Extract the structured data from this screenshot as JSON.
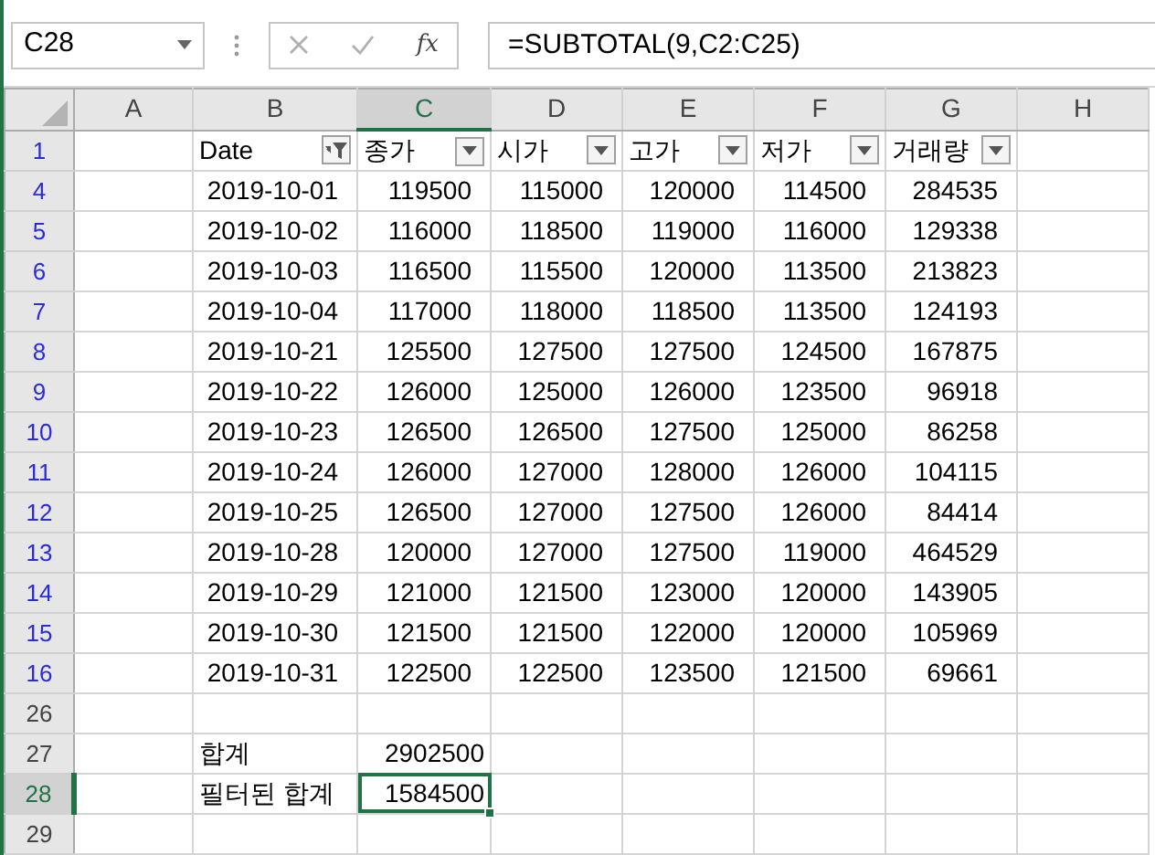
{
  "name_box": {
    "value": "C28"
  },
  "formula_bar": {
    "function_label": "fx",
    "formula": "=SUBTOTAL(9,C2:C25)"
  },
  "columns": [
    {
      "label": "A",
      "selected": false
    },
    {
      "label": "B",
      "selected": false
    },
    {
      "label": "C",
      "selected": true
    },
    {
      "label": "D",
      "selected": false
    },
    {
      "label": "E",
      "selected": false
    },
    {
      "label": "F",
      "selected": false
    },
    {
      "label": "G",
      "selected": false
    },
    {
      "label": "H",
      "selected": false
    }
  ],
  "rows": [
    {
      "number": "1",
      "kind": "header",
      "filtered": true,
      "selected": false,
      "cells": [
        null,
        {
          "text": "Date",
          "filtered": true
        },
        {
          "text": "종가",
          "filtered": false
        },
        {
          "text": "시가",
          "filtered": false
        },
        {
          "text": "고가",
          "filtered": false
        },
        {
          "text": "저가",
          "filtered": false
        },
        {
          "text": "거래량",
          "filtered": false
        }
      ]
    },
    {
      "number": "4",
      "kind": "data",
      "filtered": true,
      "selected": false,
      "cells": [
        null,
        "2019-10-01",
        "119500",
        "115000",
        "120000",
        "114500",
        "284535"
      ]
    },
    {
      "number": "5",
      "kind": "data",
      "filtered": true,
      "selected": false,
      "cells": [
        null,
        "2019-10-02",
        "116000",
        "118500",
        "119000",
        "116000",
        "129338"
      ]
    },
    {
      "number": "6",
      "kind": "data",
      "filtered": true,
      "selected": false,
      "cells": [
        null,
        "2019-10-03",
        "116500",
        "115500",
        "120000",
        "113500",
        "213823"
      ]
    },
    {
      "number": "7",
      "kind": "data",
      "filtered": true,
      "selected": false,
      "cells": [
        null,
        "2019-10-04",
        "117000",
        "118000",
        "118500",
        "113500",
        "124193"
      ]
    },
    {
      "number": "8",
      "kind": "data",
      "filtered": true,
      "selected": false,
      "cells": [
        null,
        "2019-10-21",
        "125500",
        "127500",
        "127500",
        "124500",
        "167875"
      ]
    },
    {
      "number": "9",
      "kind": "data",
      "filtered": true,
      "selected": false,
      "cells": [
        null,
        "2019-10-22",
        "126000",
        "125000",
        "126000",
        "123500",
        "96918"
      ]
    },
    {
      "number": "10",
      "kind": "data",
      "filtered": true,
      "selected": false,
      "cells": [
        null,
        "2019-10-23",
        "126500",
        "126500",
        "127500",
        "125000",
        "86258"
      ]
    },
    {
      "number": "11",
      "kind": "data",
      "filtered": true,
      "selected": false,
      "cells": [
        null,
        "2019-10-24",
        "126000",
        "127000",
        "128000",
        "126000",
        "104115"
      ]
    },
    {
      "number": "12",
      "kind": "data",
      "filtered": true,
      "selected": false,
      "cells": [
        null,
        "2019-10-25",
        "126500",
        "127000",
        "127500",
        "126000",
        "84414"
      ]
    },
    {
      "number": "13",
      "kind": "data",
      "filtered": true,
      "selected": false,
      "cells": [
        null,
        "2019-10-28",
        "120000",
        "127000",
        "127500",
        "119000",
        "464529"
      ]
    },
    {
      "number": "14",
      "kind": "data",
      "filtered": true,
      "selected": false,
      "cells": [
        null,
        "2019-10-29",
        "121000",
        "121500",
        "123000",
        "120000",
        "143905"
      ]
    },
    {
      "number": "15",
      "kind": "data",
      "filtered": true,
      "selected": false,
      "cells": [
        null,
        "2019-10-30",
        "121500",
        "121500",
        "122000",
        "120000",
        "105969"
      ]
    },
    {
      "number": "16",
      "kind": "data",
      "filtered": true,
      "selected": false,
      "cells": [
        null,
        "2019-10-31",
        "122500",
        "122500",
        "123500",
        "121500",
        "69661"
      ]
    },
    {
      "number": "26",
      "filtered": false,
      "selected": false
    },
    {
      "number": "27",
      "kind": "summary",
      "filtered": false,
      "selected": false,
      "cells": [
        null,
        "합계",
        "2902500"
      ]
    },
    {
      "number": "28",
      "kind": "summary",
      "filtered": false,
      "selected": true,
      "cells": [
        null,
        "필터된 합계",
        "1584500"
      ]
    },
    {
      "number": "29",
      "filtered": false,
      "selected": false
    }
  ]
}
